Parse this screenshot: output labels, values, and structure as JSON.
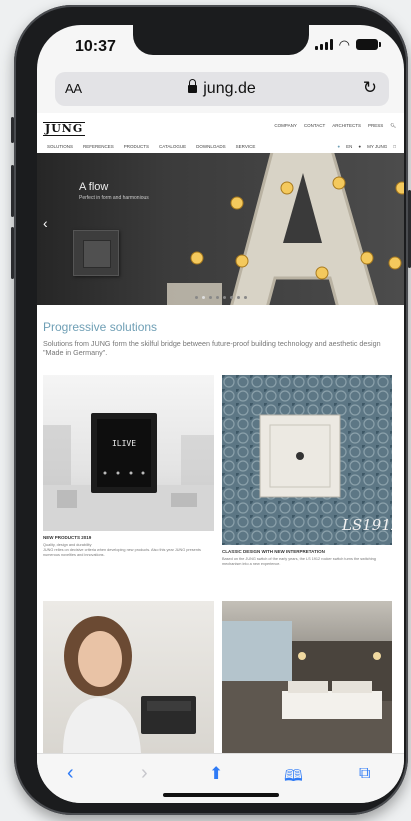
{
  "status_bar": {
    "time": "10:37"
  },
  "browser": {
    "aa_label": "AA",
    "url": "jung.de"
  },
  "site": {
    "logo": "JUNG",
    "top_links": [
      "COMPANY",
      "CONTACT",
      "ARCHITECTS",
      "PRESS"
    ],
    "nav": [
      "SOLUTIONS",
      "REFERENCES",
      "PRODUCTS",
      "CATALOGUE",
      "DOWNLOADS",
      "SERVICE"
    ],
    "nav_right": [
      "EN",
      "MY JUNG"
    ]
  },
  "hero": {
    "title": "A flow",
    "subtitle": "Perfect in form and harmonious",
    "slide_count": 8,
    "active_slide": 1
  },
  "section": {
    "title": "Progressive solutions",
    "text": "Solutions from JUNG form the skilful bridge between future-proof building technology and aesthetic design \"Made in Germany\"."
  },
  "tiles": [
    {
      "title": "NEW PRODUCTS 2019",
      "text": "Quality, design and durability\nJUNG relies on decisive criteria when developing new products. Also this year JUNG presents numerous novelties and innovations.",
      "screen_text": "ILIVE"
    },
    {
      "title": "CLASSIC DESIGN WITH NEW INTERPRETATION",
      "text": "Based on the JUNG switch of the early years, the LS 1912 rocker switch turns the switching mechanism into a new experience.",
      "overlay": "LS1912"
    }
  ],
  "colors": {
    "accent": "#6f9fb5",
    "hero_bg": "#333333"
  }
}
